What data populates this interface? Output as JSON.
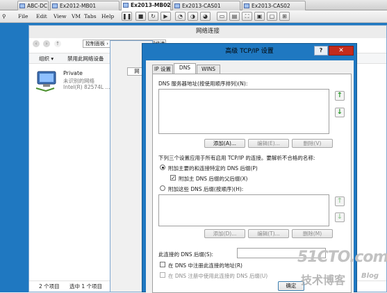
{
  "vm_tabs": [
    {
      "label": "ABC-DC",
      "active": false
    },
    {
      "label": "Ex2012-MB01",
      "active": false
    },
    {
      "label": "Ex2013-MB02",
      "active": true
    },
    {
      "label": "Ex2013-CAS01",
      "active": false
    },
    {
      "label": "Ex2013-CAS02",
      "active": false
    }
  ],
  "vm_menu": [
    "File",
    "Edit",
    "View",
    "VM",
    "Tabs",
    "Help"
  ],
  "net_window": {
    "title": "网络连接",
    "address": "控制面板 › 网络和 Internet › 网络连接",
    "commands": {
      "organize": "组织 ▾",
      "disable": "禁用此网络设备"
    },
    "adapter": {
      "name": "Private",
      "status": "未识别的网络",
      "device": "Intel(R) 82574L ..."
    },
    "status": {
      "count": "2 个项目",
      "selected": "选中 1 个项目"
    }
  },
  "prop_window": {
    "tab_label": "网"
  },
  "dialog": {
    "title": "高级 TCP/IP 设置",
    "help": "?",
    "close": "✕",
    "tabs": [
      "IP 设置",
      "DNS",
      "WINS"
    ],
    "dns_servers_label": "DNS 服务器地址(按使用顺序排列)(N):",
    "buttons1": {
      "add": "添加(A)...",
      "edit": "编辑(E)...",
      "remove": "删除(V)"
    },
    "settings_label": "下列三个设置应用于所有启用 TCP/IP 的连接。要解析不合格的名称:",
    "radio_primary": "附加主要的和连接特定的 DNS 后缀(P)",
    "check_parent": "附加主 DNS 后缀的父后缀(X)",
    "radio_these": "附加这些 DNS 后缀(按顺序)(H):",
    "buttons2": {
      "add": "添加(D)...",
      "edit": "编辑(T)...",
      "remove": "删除(M)"
    },
    "suffix_label": "此连接的 DNS 后缀(S):",
    "check_register": "在 DNS 中注册此连接的地址(R)",
    "check_use_suffix": "在 DNS 注册中使用此连接的 DNS 后缀(U)",
    "ok": "确定"
  },
  "watermark": {
    "site": "51CTO.com",
    "sub": "技术博客",
    "blog": "Blog"
  }
}
